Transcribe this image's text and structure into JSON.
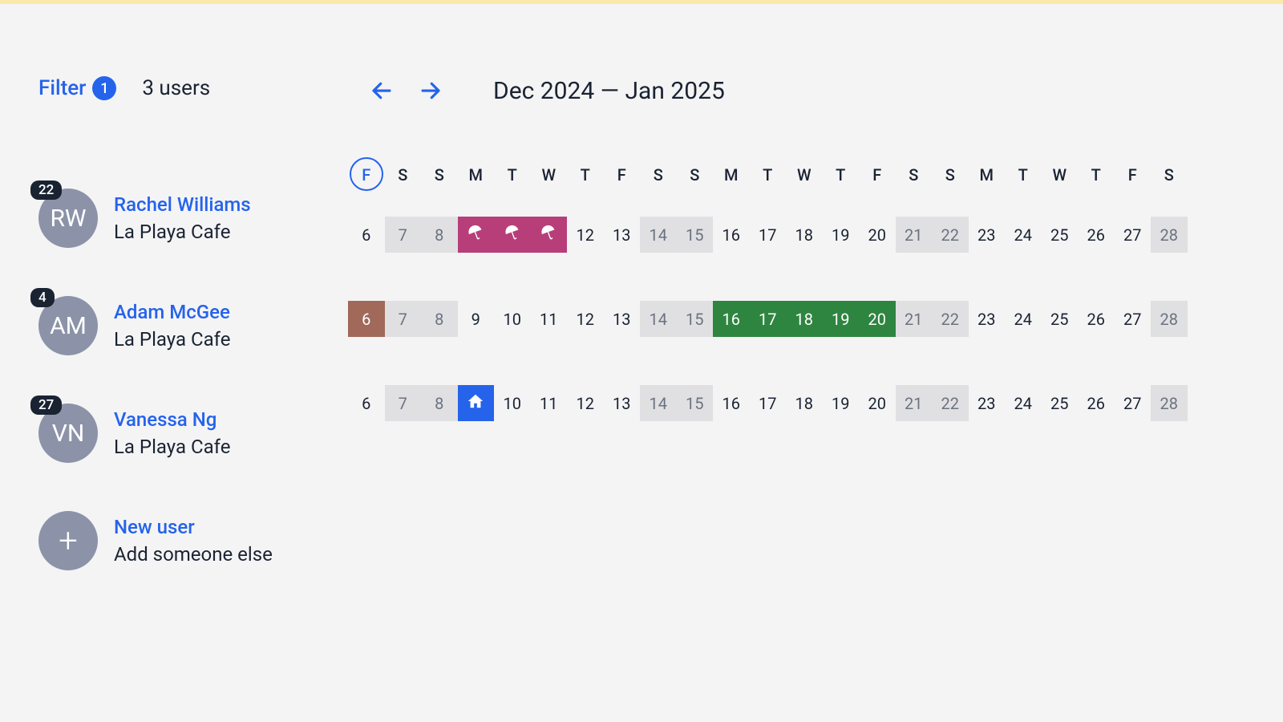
{
  "header": {
    "filter_label": "Filter",
    "filter_count": "1",
    "users_count": "3 users",
    "date_range": "Dec 2024 — Jan 2025"
  },
  "day_headers": [
    "F",
    "S",
    "S",
    "M",
    "T",
    "W",
    "T",
    "F",
    "S",
    "S",
    "M",
    "T",
    "W",
    "T",
    "F",
    "S",
    "S",
    "M",
    "T",
    "W",
    "T",
    "F",
    "S"
  ],
  "today_index": 0,
  "users": [
    {
      "initials": "RW",
      "badge": "22",
      "name": "Rachel Williams",
      "sub": "La Playa Cafe",
      "cells": [
        {
          "n": "6",
          "t": "plain"
        },
        {
          "n": "7",
          "t": "weekend"
        },
        {
          "n": "8",
          "t": "weekend"
        },
        {
          "n": "",
          "t": "pink",
          "icon": "umbrella"
        },
        {
          "n": "",
          "t": "pink",
          "icon": "umbrella"
        },
        {
          "n": "",
          "t": "pink",
          "icon": "umbrella"
        },
        {
          "n": "12",
          "t": "plain"
        },
        {
          "n": "13",
          "t": "plain"
        },
        {
          "n": "14",
          "t": "weekend"
        },
        {
          "n": "15",
          "t": "weekend"
        },
        {
          "n": "16",
          "t": "plain"
        },
        {
          "n": "17",
          "t": "plain"
        },
        {
          "n": "18",
          "t": "plain"
        },
        {
          "n": "19",
          "t": "plain"
        },
        {
          "n": "20",
          "t": "plain"
        },
        {
          "n": "21",
          "t": "weekend"
        },
        {
          "n": "22",
          "t": "weekend"
        },
        {
          "n": "23",
          "t": "plain"
        },
        {
          "n": "24",
          "t": "plain"
        },
        {
          "n": "25",
          "t": "plain"
        },
        {
          "n": "26",
          "t": "plain"
        },
        {
          "n": "27",
          "t": "plain"
        },
        {
          "n": "28",
          "t": "weekend"
        }
      ]
    },
    {
      "initials": "AM",
      "badge": "4",
      "name": "Adam McGee",
      "sub": "La Playa Cafe",
      "cells": [
        {
          "n": "6",
          "t": "brown"
        },
        {
          "n": "7",
          "t": "weekend"
        },
        {
          "n": "8",
          "t": "weekend"
        },
        {
          "n": "9",
          "t": "plain"
        },
        {
          "n": "10",
          "t": "plain"
        },
        {
          "n": "11",
          "t": "plain"
        },
        {
          "n": "12",
          "t": "plain"
        },
        {
          "n": "13",
          "t": "plain"
        },
        {
          "n": "14",
          "t": "weekend"
        },
        {
          "n": "15",
          "t": "weekend"
        },
        {
          "n": "16",
          "t": "green"
        },
        {
          "n": "17",
          "t": "green"
        },
        {
          "n": "18",
          "t": "green"
        },
        {
          "n": "19",
          "t": "green"
        },
        {
          "n": "20",
          "t": "green"
        },
        {
          "n": "21",
          "t": "weekend"
        },
        {
          "n": "22",
          "t": "weekend"
        },
        {
          "n": "23",
          "t": "plain"
        },
        {
          "n": "24",
          "t": "plain"
        },
        {
          "n": "25",
          "t": "plain"
        },
        {
          "n": "26",
          "t": "plain"
        },
        {
          "n": "27",
          "t": "plain"
        },
        {
          "n": "28",
          "t": "weekend"
        }
      ]
    },
    {
      "initials": "VN",
      "badge": "27",
      "name": "Vanessa Ng",
      "sub": "La Playa Cafe",
      "cells": [
        {
          "n": "6",
          "t": "plain"
        },
        {
          "n": "7",
          "t": "weekend"
        },
        {
          "n": "8",
          "t": "weekend"
        },
        {
          "n": "",
          "t": "blue",
          "icon": "home"
        },
        {
          "n": "10",
          "t": "plain"
        },
        {
          "n": "11",
          "t": "plain"
        },
        {
          "n": "12",
          "t": "plain"
        },
        {
          "n": "13",
          "t": "plain"
        },
        {
          "n": "14",
          "t": "weekend"
        },
        {
          "n": "15",
          "t": "weekend"
        },
        {
          "n": "16",
          "t": "plain"
        },
        {
          "n": "17",
          "t": "plain"
        },
        {
          "n": "18",
          "t": "plain"
        },
        {
          "n": "19",
          "t": "plain"
        },
        {
          "n": "20",
          "t": "plain"
        },
        {
          "n": "21",
          "t": "weekend"
        },
        {
          "n": "22",
          "t": "weekend"
        },
        {
          "n": "23",
          "t": "plain"
        },
        {
          "n": "24",
          "t": "plain"
        },
        {
          "n": "25",
          "t": "plain"
        },
        {
          "n": "26",
          "t": "plain"
        },
        {
          "n": "27",
          "t": "plain"
        },
        {
          "n": "28",
          "t": "weekend"
        }
      ]
    }
  ],
  "new_user": {
    "title": "New user",
    "sub": "Add someone else",
    "glyph": "+"
  }
}
